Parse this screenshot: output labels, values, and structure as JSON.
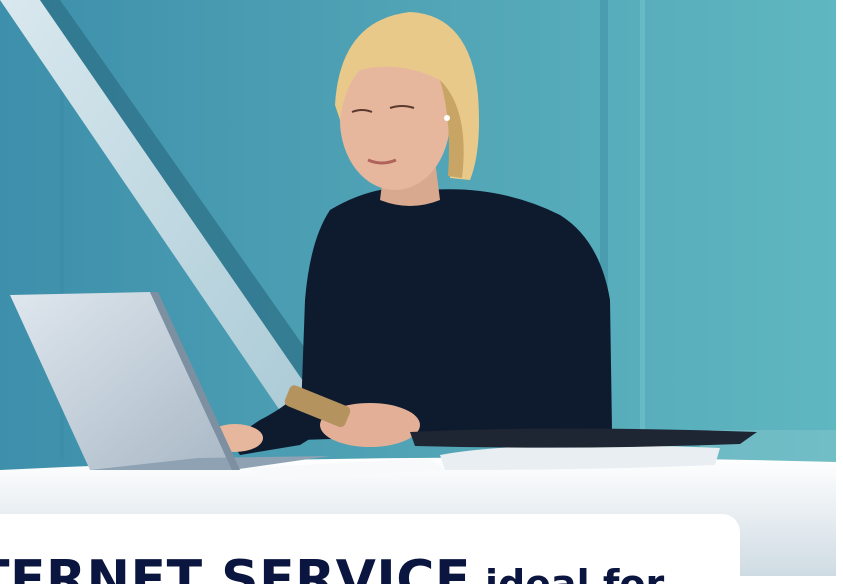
{
  "photo": {
    "alt_subject": "woman-at-laptop-with-phone",
    "palette": {
      "wall": "#56adb9",
      "wall_dark": "#3f8fa6",
      "sweater": "#0d1a2d",
      "hair": "#e9c98a",
      "skin": "#e6b79d",
      "desk": "#eef3f6",
      "laptop": "#c8d4de"
    }
  },
  "headline": {
    "main": "TERNET SERVICE",
    "tail": "ideal for"
  },
  "colors": {
    "headline": "#0b1640",
    "card": "#ffffff"
  }
}
